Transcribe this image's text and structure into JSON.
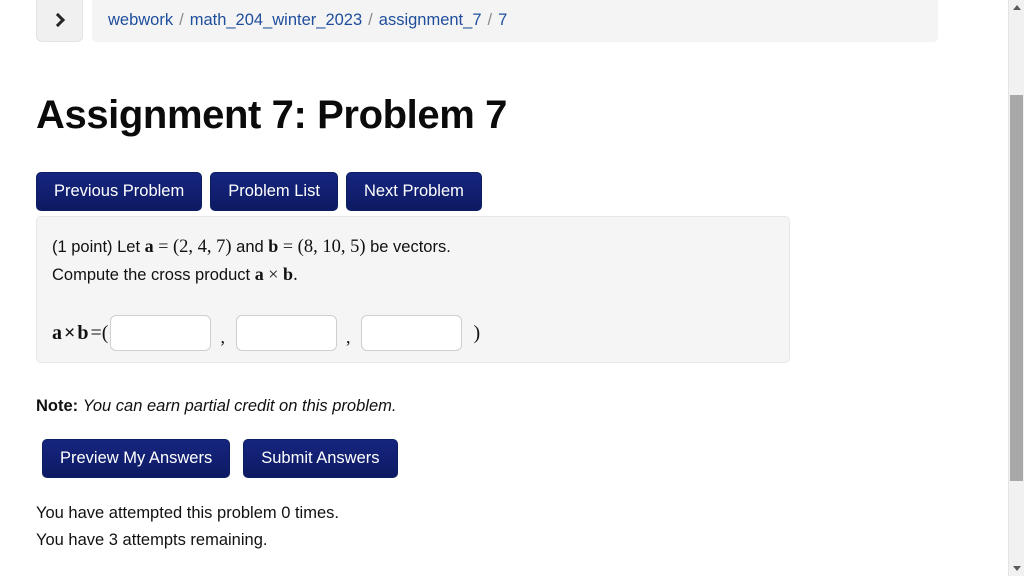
{
  "breadcrumb": {
    "toggle_icon": "chevron-right-icon",
    "items": [
      {
        "label": "webwork"
      },
      {
        "label": "math_204_winter_2023"
      },
      {
        "label": "assignment_7"
      },
      {
        "label": "7"
      }
    ],
    "separator": "/"
  },
  "page_title": "Assignment 7: Problem 7",
  "nav_buttons": [
    {
      "label": "Previous Problem"
    },
    {
      "label": "Problem List"
    },
    {
      "label": "Next Problem"
    }
  ],
  "problem": {
    "points": "(1 point)",
    "line1_pre": "Let",
    "vec_a": "a",
    "eq1": "=",
    "a_value": "(2, 4, 7)",
    "and": "and",
    "vec_b": "b",
    "eq2": "=",
    "b_value": "(8, 10, 5)",
    "line1_post": "be vectors.",
    "line2_pre": "Compute the cross product",
    "cross_symbol": "×",
    "line2_post": ".",
    "answer_label_a": "a",
    "answer_label_b": "b",
    "answer_equals": "=(",
    "answer_close": ")",
    "answer_comma": ",",
    "inputs": [
      {
        "value": "",
        "placeholder": ""
      },
      {
        "value": "",
        "placeholder": ""
      },
      {
        "value": "",
        "placeholder": ""
      }
    ]
  },
  "note": {
    "label": "Note:",
    "text": "You can earn partial credit on this problem."
  },
  "action_buttons": [
    {
      "label": "Preview My Answers"
    },
    {
      "label": "Submit Answers"
    }
  ],
  "attempts": {
    "line1": "You have attempted this problem 0 times.",
    "line2": "You have 3 attempts remaining."
  },
  "scrollbar": {
    "up_icon": "triangle-up-icon",
    "down_icon": "triangle-down-icon"
  },
  "colors": {
    "button_blue": "#122073",
    "link_blue": "#1f4e9c",
    "panel_gray": "#f5f5f5"
  }
}
